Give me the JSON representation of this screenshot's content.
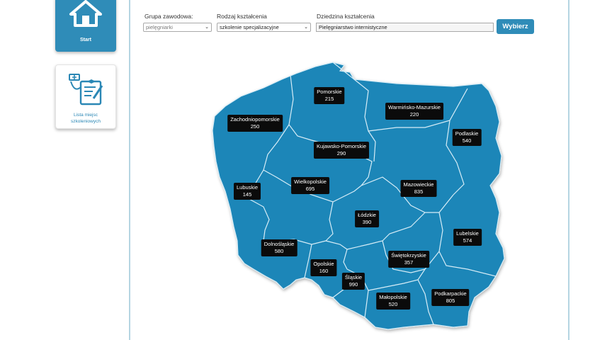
{
  "sidebar": {
    "start": {
      "label": "Start",
      "icon": "house-icon"
    },
    "training_places": {
      "label_line1": "Lista miejsc",
      "label_line2": "szkoleniowych",
      "icon": "nurse-certificate-icon"
    }
  },
  "filters": {
    "group": {
      "label": "Grupa zawodowa:",
      "value": "pielęgniarki"
    },
    "training_type": {
      "label": "Rodzaj kształcenia",
      "value": "szkolenie specjalizacyjne"
    },
    "field": {
      "label": "Dziedzina kształcenia",
      "value": "Pielęgniarstwo internistyczne"
    },
    "submit_label": "Wybierz"
  },
  "colors": {
    "accent": "#2f8cb8",
    "map_fill": "#1a86b8",
    "map_border": "#d7edf7",
    "label_bg": "#0b0b0b"
  },
  "map": {
    "regions": [
      {
        "key": "pomorskie",
        "name": "Pomorskie",
        "count": "215"
      },
      {
        "key": "warminsko",
        "name": "Warmińsko-Mazurskie",
        "count": "220"
      },
      {
        "key": "zachodniopomorskie",
        "name": "Zachodniopomorskie",
        "count": "250"
      },
      {
        "key": "podlaskie",
        "name": "Podlaskie",
        "count": "540"
      },
      {
        "key": "kujawsko",
        "name": "Kujawsko-Pomorskie",
        "count": "290"
      },
      {
        "key": "lubuskie",
        "name": "Lubuskie",
        "count": "145"
      },
      {
        "key": "wielkopolskie",
        "name": "Wielkopolskie",
        "count": "695"
      },
      {
        "key": "mazowieckie",
        "name": "Mazowieckie",
        "count": "835"
      },
      {
        "key": "lodzkie",
        "name": "Łódzkie",
        "count": "390"
      },
      {
        "key": "lubelskie",
        "name": "Lubelskie",
        "count": "574"
      },
      {
        "key": "dolnoslaskie",
        "name": "Dolnośląskie",
        "count": "580"
      },
      {
        "key": "swietokrzyskie",
        "name": "Świętokrzyskie",
        "count": "357"
      },
      {
        "key": "opolskie",
        "name": "Opolskie",
        "count": "160"
      },
      {
        "key": "slaskie",
        "name": "Śląskie",
        "count": "990"
      },
      {
        "key": "podkarpackie",
        "name": "Podkarpackie",
        "count": "805"
      },
      {
        "key": "malopolskie",
        "name": "Małopolskie",
        "count": "520"
      }
    ]
  }
}
